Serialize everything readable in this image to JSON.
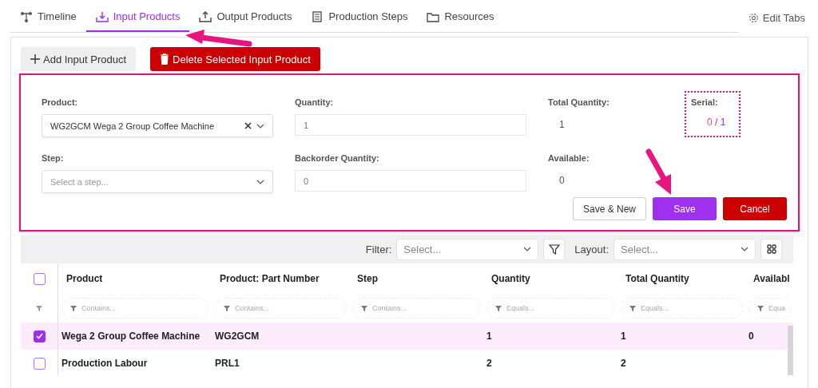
{
  "tabs": [
    {
      "label": "Timeline",
      "selected": false
    },
    {
      "label": "Input Products",
      "selected": true
    },
    {
      "label": "Output Products",
      "selected": false
    },
    {
      "label": "Production Steps",
      "selected": false
    },
    {
      "label": "Resources",
      "selected": false
    }
  ],
  "edit_tabs": "Edit Tabs",
  "toolbar": {
    "add_button": "Add Input Product",
    "delete_button": "Delete Selected Input Product"
  },
  "form": {
    "product": {
      "label": "Product:",
      "value": "WG2GCM Wega 2 Group Coffee Machine"
    },
    "step": {
      "label": "Step:",
      "placeholder": "Select a step..."
    },
    "quantity": {
      "label": "Quantity:",
      "value": "1"
    },
    "backorder_quantity": {
      "label": "Backorder Quantity:",
      "value": "0"
    },
    "total_quantity": {
      "label": "Total Quantity:",
      "value": "1"
    },
    "available": {
      "label": "Available:",
      "value": "0"
    },
    "serial": {
      "label": "Serial:",
      "count": "0",
      "separator": "/",
      "total": "1"
    },
    "buttons": {
      "save_new": "Save & New",
      "save": "Save",
      "cancel": "Cancel"
    }
  },
  "grid_toolbar": {
    "filter_label": "Filter:",
    "filter_placeholder": "Select...",
    "layout_label": "Layout:",
    "layout_placeholder": "Select..."
  },
  "table": {
    "columns": [
      {
        "label": "Product",
        "filter": "Contains..."
      },
      {
        "label": "Product: Part Number",
        "filter": "Contains..."
      },
      {
        "label": "Step",
        "filter": "Contains..."
      },
      {
        "label": "Quantity",
        "filter": "Equals..."
      },
      {
        "label": "Total Quantity",
        "filter": "Equals..."
      },
      {
        "label": "Availabl",
        "filter": "Equa"
      }
    ],
    "header_checked": false,
    "rows": [
      {
        "selected": true,
        "cells": [
          "Wega 2 Group Coffee Machine",
          "WG2GCM",
          null,
          "1",
          "1",
          "0"
        ]
      },
      {
        "selected": false,
        "cells": [
          "Production Labour",
          "PRL1",
          null,
          "2",
          "2",
          null
        ]
      }
    ]
  }
}
